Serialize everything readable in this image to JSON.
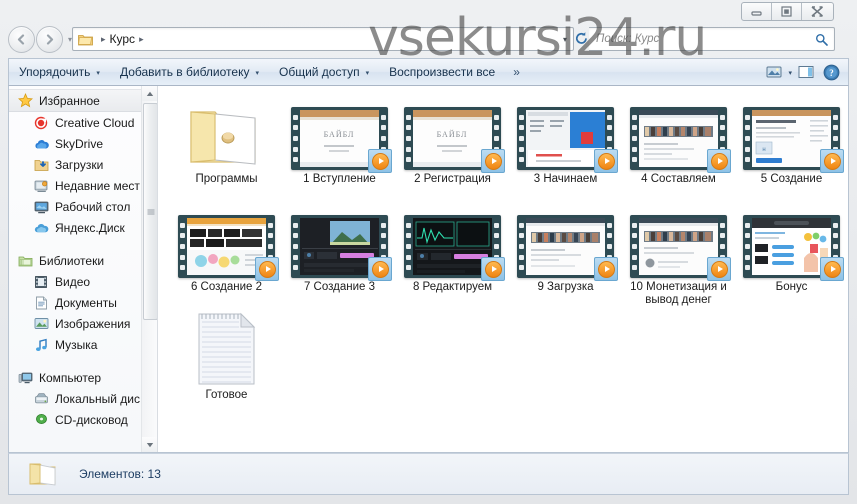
{
  "window": {
    "controls": {
      "minimize": "Свернуть",
      "maximize": "Развернуть",
      "close": "Закрыть"
    }
  },
  "watermark": {
    "text": "vsekursi24.ru"
  },
  "address": {
    "back": "Назад",
    "forward": "Вперед",
    "history_dropdown": "Последние страницы",
    "crumb": "Курс",
    "separator": "▸",
    "dropdown": "▾",
    "refresh": "Обновить"
  },
  "search": {
    "placeholder": "Поиск: Курс",
    "value": ""
  },
  "toolbar": {
    "organize": "Упорядочить",
    "add_to_library": "Добавить в библиотеку",
    "share": "Общий доступ",
    "play_all": "Воспроизвести все",
    "overflow": "»",
    "caret": "▾",
    "view_label": "Изменить представление",
    "preview_label": "Область предпросмотра",
    "help_label": "Справка"
  },
  "sidebar": {
    "groups": [
      {
        "header": {
          "label": "Избранное",
          "icon": "star-icon",
          "selected": true
        },
        "items": [
          {
            "label": "Creative Cloud",
            "icon": "creative-cloud-icon"
          },
          {
            "label": "SkyDrive",
            "icon": "skydrive-icon"
          },
          {
            "label": "Загрузки",
            "icon": "downloads-icon"
          },
          {
            "label": "Недавние мест",
            "icon": "recent-places-icon"
          },
          {
            "label": "Рабочий стол",
            "icon": "desktop-icon"
          },
          {
            "label": "Яндекс.Диск",
            "icon": "yandex-disk-icon"
          }
        ]
      },
      {
        "header": {
          "label": "Библиотеки",
          "icon": "libraries-icon",
          "selected": false
        },
        "items": [
          {
            "label": "Видео",
            "icon": "video-library-icon"
          },
          {
            "label": "Документы",
            "icon": "documents-library-icon"
          },
          {
            "label": "Изображения",
            "icon": "pictures-library-icon"
          },
          {
            "label": "Музыка",
            "icon": "music-library-icon"
          }
        ]
      },
      {
        "header": {
          "label": "Компьютер",
          "icon": "computer-icon",
          "selected": false
        },
        "items": [
          {
            "label": "Локальный дис",
            "icon": "hard-drive-icon"
          },
          {
            "label": "CD-дисковод",
            "icon": "cd-drive-icon"
          }
        ]
      }
    ]
  },
  "files": [
    {
      "name": "Программы",
      "type": "folder"
    },
    {
      "name": "1 Вступление",
      "type": "video",
      "shot": "title-slide"
    },
    {
      "name": "2 Регистрация",
      "type": "video",
      "shot": "title-slide"
    },
    {
      "name": "3 Начинаем",
      "type": "video",
      "shot": "app-blue"
    },
    {
      "name": "4 Составляем",
      "type": "video",
      "shot": "web-people"
    },
    {
      "name": "5 Создание",
      "type": "video",
      "shot": "web-article"
    },
    {
      "name": "6 Создание 2",
      "type": "video",
      "shot": "editor-colorful"
    },
    {
      "name": "7 Создание 3",
      "type": "video",
      "shot": "timeline-dark"
    },
    {
      "name": "8 Редактируем",
      "type": "video",
      "shot": "waveform-dark"
    },
    {
      "name": "9 Загрузка",
      "type": "video",
      "shot": "web-people"
    },
    {
      "name": "10 Монетизация и вывод денег",
      "type": "video",
      "shot": "web-people"
    },
    {
      "name": "Бонус",
      "type": "video",
      "shot": "web-shop"
    },
    {
      "name": "Готовое",
      "type": "text-document"
    }
  ],
  "status": {
    "items_count_label": "Элементов: 13",
    "icon": "folder-icon"
  },
  "colors": {
    "toolbar_text": "#17324d",
    "film_border": "#2e4b53",
    "play_badge": "#ef8412",
    "status_text": "#1d3d63",
    "window_chrome": "#e7e9ec"
  }
}
